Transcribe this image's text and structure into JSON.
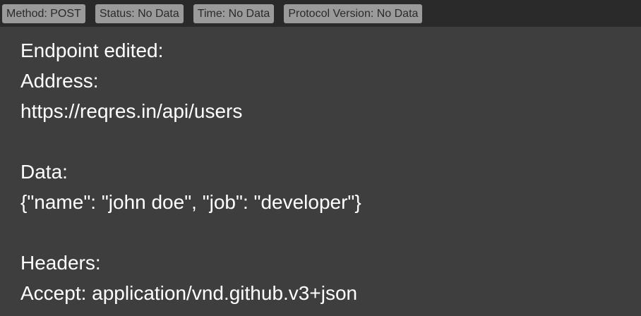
{
  "status_bar": {
    "method": "Method: POST",
    "status": "Status: No Data",
    "time": "Time: No Data",
    "protocol": "Protocol Version: No Data"
  },
  "content": {
    "heading": "Endpoint edited:",
    "address_label": "Address:",
    "address_value": "https://reqres.in/api/users",
    "data_label": "Data:",
    "data_value": "{\"name\": \"john doe\", \"job\": \"developer\"}",
    "headers_label": "Headers:",
    "headers_value": "Accept: application/vnd.github.v3+json"
  },
  "colors": {
    "topbar_bg": "#2a2a2a",
    "badge_bg": "#9a9a9a",
    "badge_text": "#2a2a2a",
    "content_bg": "#3e3e3e",
    "content_text": "#ffffff"
  }
}
